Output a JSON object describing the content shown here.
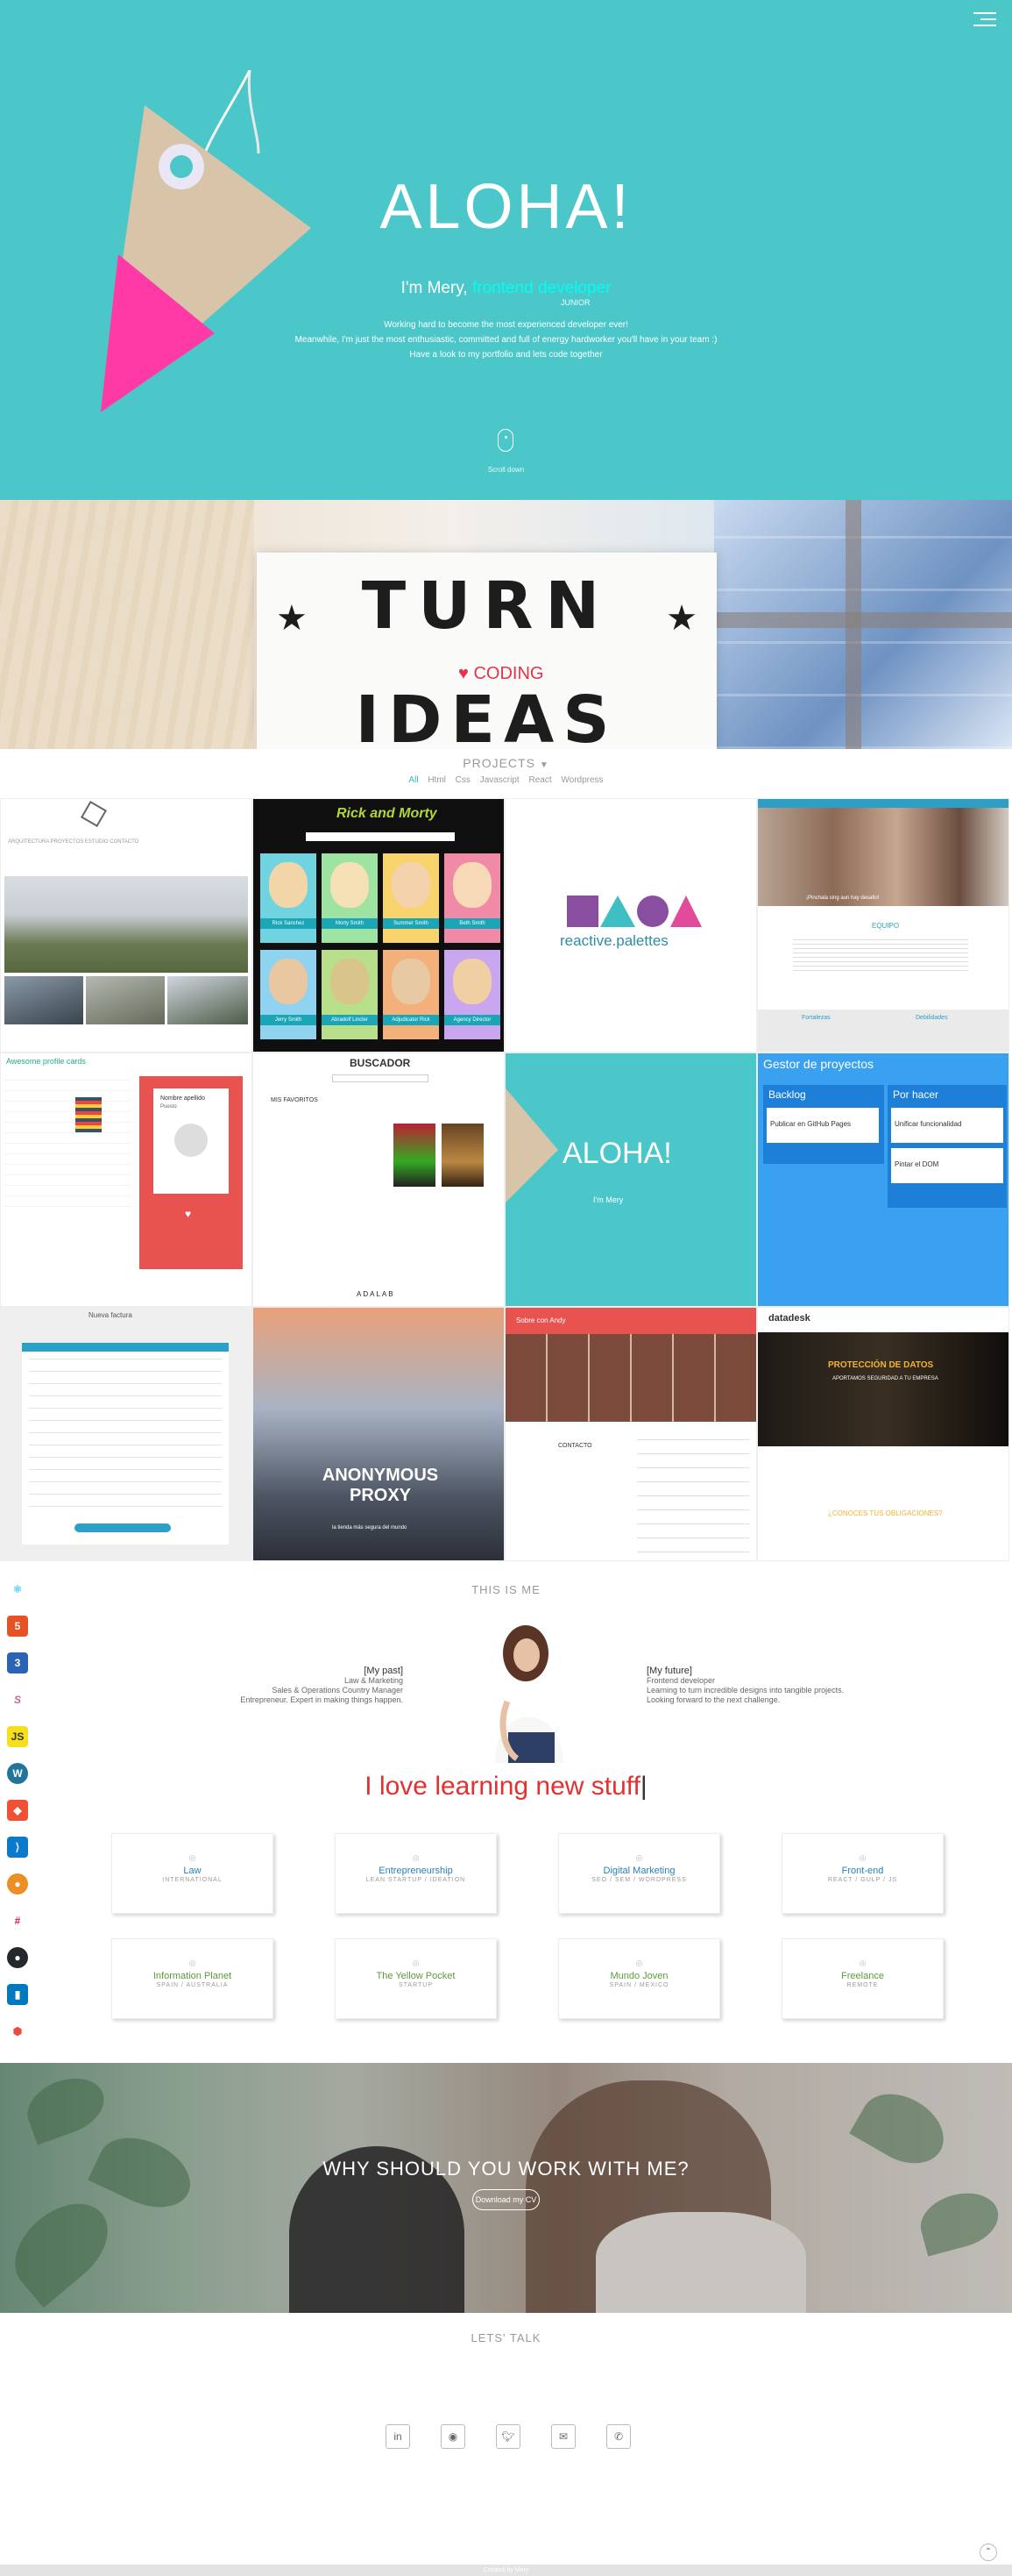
{
  "hero": {
    "title": "ALOHA!",
    "intro_prefix": "I'm Mery, ",
    "intro_highlight": "frontend developer",
    "intro_sub": "JUNIOR",
    "line1": "Working hard to become the most experienced developer ever!",
    "line2": "Meanwhile, I'm just the most enthusiastic, committed and full of energy hardworker you'll have in your team :)",
    "line3": "Have a look to my portfolio and lets code together",
    "scroll_label": "Scroll down",
    "accent": "#4cc7c9"
  },
  "banner": {
    "word1": "TURN",
    "word2": "IDEAS INTO",
    "overlay": "CODING"
  },
  "projects": {
    "title": "PROJECTS",
    "filters": [
      "All",
      "Html",
      "Css",
      "Javascript",
      "React",
      "Wordpress"
    ],
    "active_filter": "All",
    "tiles": {
      "architecture_nav": "ARQUITECTURA  PROYECTOS  ESTUDIO  CONTACTO",
      "rick_logo": "Rick and Morty",
      "rick_names": [
        "Rick Sanchez",
        "Morty Smith",
        "Summer Smith",
        "Beth Smith",
        "Jerry Smith",
        "Abradolf Lincler",
        "Adjudicator Rick",
        "Agency Director"
      ],
      "palettes_brand": "reactive.palettes",
      "team_nav": "EQUIPO",
      "team_caption": "¡Pinchala sing aun hay desafio!",
      "team_col1": "Fortalezas",
      "team_col2": "Debilidades",
      "profile_header": "Awesome profile cards",
      "profile_name": "Nombre apellido",
      "profile_role": "Puesto",
      "search_title": "BUSCADOR",
      "search_fav": "MIS FAVORITOS",
      "search_brand": "ADALAB",
      "aloha_title": "ALOHA!",
      "aloha_sub": "I'm Mery",
      "kanban_title": "Gestor de proyectos",
      "kanban_col1": "Backlog",
      "kanban_col2": "Por hacer",
      "kanban_card1": "Publicar en GitHub Pages",
      "kanban_card2": "Unificar funcionalidad",
      "kanban_card3": "Pintar el DOM",
      "form_title": "Nueva factura",
      "proxy_title": "ANONYMOUS PROXY",
      "proxy_sub": "la tienda más segura del mundo",
      "andy_nav": "Sobre con Andy",
      "andy_contact": "CONTACTO",
      "data_brand": "datadesk",
      "data_title": "PROTECCIÓN DE DATOS",
      "data_sub": "APORTAMOS SEGURIDAD A TU EMPRESA",
      "data_q": "¿CONOCES TUS OBLIGACIONES?"
    }
  },
  "about": {
    "title": "THIS IS ME",
    "skills": [
      "react",
      "html5",
      "css3",
      "sass",
      "js",
      "wordpress",
      "git",
      "vscode",
      "gulp",
      "slack",
      "github",
      "trello",
      "yarn"
    ],
    "past_heading": "[My past]",
    "past_lines": [
      "Law & Marketing",
      "Sales & Operations Country Manager",
      "Entrepreneur. Expert in making things happen."
    ],
    "future_heading": "[My future]",
    "future_lines": [
      "Frontend developer",
      "Learning to turn incredible designs into tangible projects.",
      "Looking forward to the next challenge."
    ],
    "typed": "I love learning new stuff",
    "cards": [
      {
        "title": "Law",
        "sub": "INTERNATIONAL"
      },
      {
        "title": "Entrepreneurship",
        "sub": "LEAN STARTUP / IDEATION"
      },
      {
        "title": "Digital Marketing",
        "sub": "SEO / SEM / WORDPRESS"
      },
      {
        "title": "Front-end",
        "sub": "REACT / GULP / JS"
      },
      {
        "title": "Information Planet",
        "sub": "SPAIN / AUSTRALIA"
      },
      {
        "title": "The Yellow Pocket",
        "sub": "STARTUP"
      },
      {
        "title": "Mundo Joven",
        "sub": "SPAIN / MEXICO"
      },
      {
        "title": "Freelance",
        "sub": "REMOTE"
      }
    ]
  },
  "why": {
    "title": "WHY SHOULD YOU WORK WITH ME?",
    "cv_label": "Download my CV"
  },
  "contact": {
    "title": "LETS' TALK",
    "icons": [
      "linkedin-icon",
      "github-icon",
      "twitter-icon",
      "mail-icon",
      "phone-icon"
    ]
  },
  "footer": {
    "text": "Created by Mery"
  }
}
